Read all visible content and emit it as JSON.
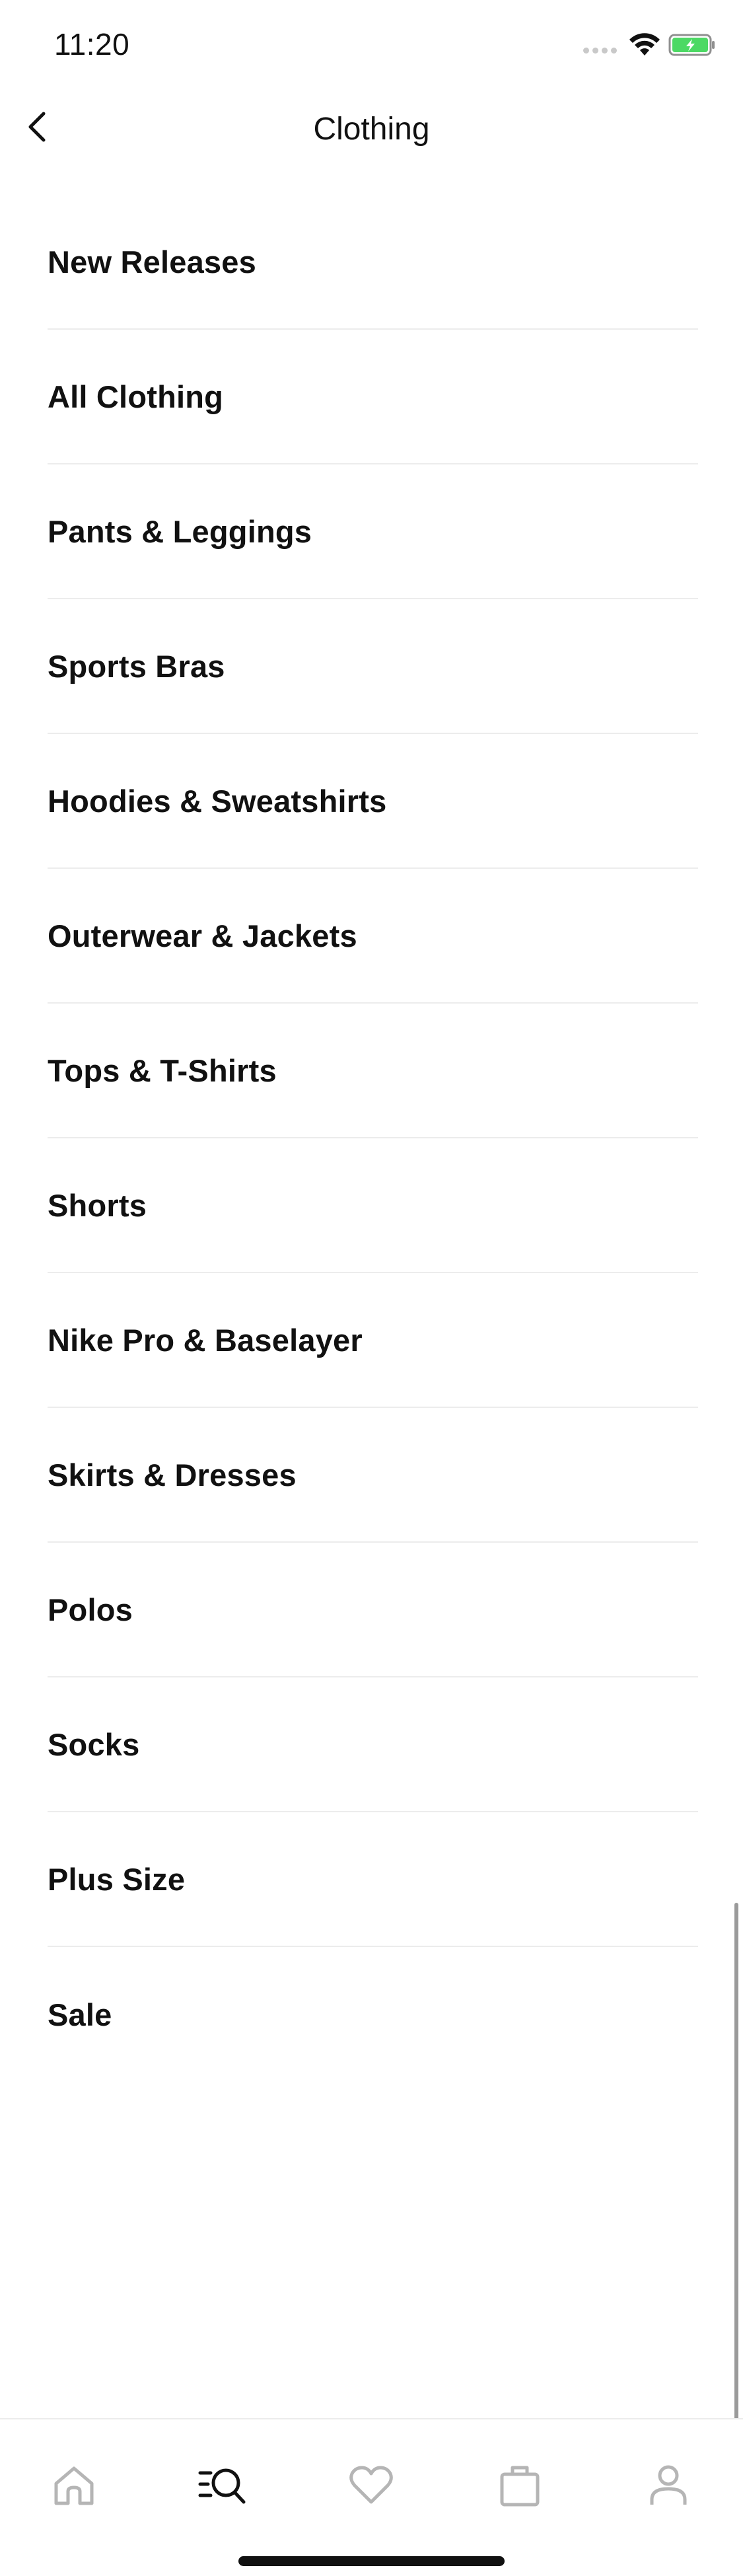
{
  "status_bar": {
    "time": "11:20"
  },
  "header": {
    "title": "Clothing",
    "back_icon": "chevron-left-icon"
  },
  "menu": {
    "items": [
      {
        "label": "New Releases"
      },
      {
        "label": "All Clothing"
      },
      {
        "label": "Pants & Leggings"
      },
      {
        "label": "Sports Bras"
      },
      {
        "label": "Hoodies & Sweatshirts"
      },
      {
        "label": "Outerwear & Jackets"
      },
      {
        "label": "Tops & T-Shirts"
      },
      {
        "label": "Shorts"
      },
      {
        "label": "Nike Pro & Baselayer"
      },
      {
        "label": "Skirts & Dresses"
      },
      {
        "label": "Polos"
      },
      {
        "label": "Socks"
      },
      {
        "label": "Plus Size"
      },
      {
        "label": "Sale"
      }
    ]
  },
  "tab_bar": {
    "tabs": [
      {
        "icon": "home-icon",
        "active": false
      },
      {
        "icon": "search-icon",
        "active": true
      },
      {
        "icon": "heart-icon",
        "active": false
      },
      {
        "icon": "bag-icon",
        "active": false
      },
      {
        "icon": "profile-icon",
        "active": false
      }
    ]
  },
  "colors": {
    "text": "#111111",
    "divider": "#ececec",
    "inactive_icon": "#b5b5b5",
    "battery_fill": "#4cd964"
  }
}
